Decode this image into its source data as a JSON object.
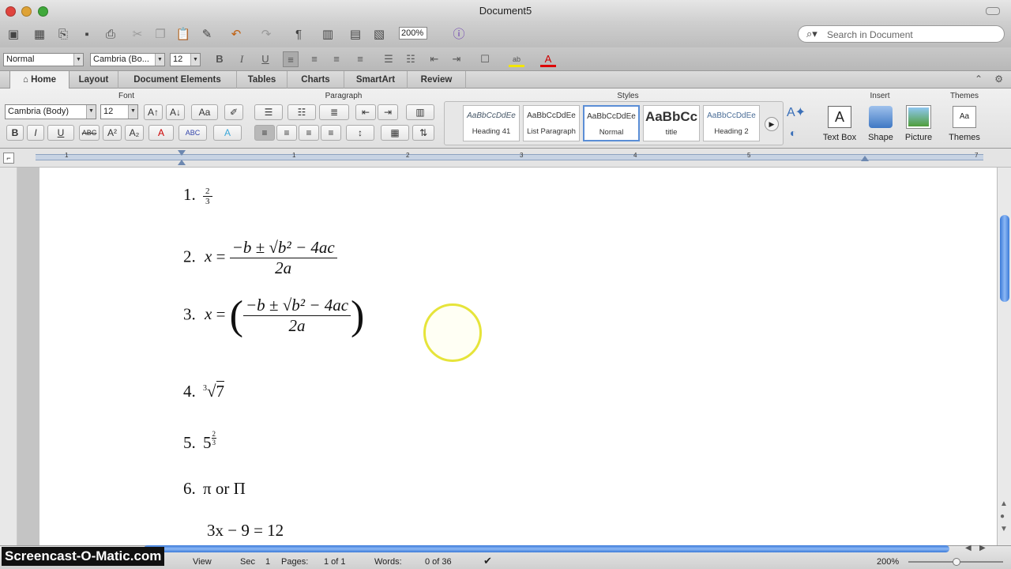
{
  "window": {
    "title": "Document5"
  },
  "toolbar": {
    "zoom": "200%",
    "search_placeholder": "Search in Document"
  },
  "format_bar": {
    "style": "Normal",
    "font": "Cambria (Bo...",
    "size": "12"
  },
  "ribbon_tabs": [
    "Home",
    "Layout",
    "Document Elements",
    "Tables",
    "Charts",
    "SmartArt",
    "Review"
  ],
  "ribbon": {
    "groups": {
      "font": "Font",
      "paragraph": "Paragraph",
      "styles": "Styles",
      "insert": "Insert",
      "themes": "Themes"
    },
    "font_name": "Cambria (Body)",
    "font_size": "12",
    "styles": [
      {
        "preview": "AaBbCcDdEe",
        "name": "Heading 41"
      },
      {
        "preview": "AaBbCcDdEe",
        "name": "List Paragraph"
      },
      {
        "preview": "AaBbCcDdEe",
        "name": "Normal"
      },
      {
        "preview": "AaBbCc",
        "name": "title"
      },
      {
        "preview": "AaBbCcDdEe",
        "name": "Heading 2"
      }
    ],
    "insert_items": [
      "Text Box",
      "Shape",
      "Picture"
    ],
    "themes_label": "Themes"
  },
  "ruler": {
    "numbers": [
      "1",
      "1",
      "2",
      "3",
      "4",
      "5",
      "7"
    ]
  },
  "document": {
    "eq1": {
      "n": "1.",
      "num": "2",
      "den": "3"
    },
    "eq2": {
      "n": "2.",
      "lhs": "x",
      "num": "−b ± √b² − 4ac",
      "den": "2a"
    },
    "eq3": {
      "n": "3.",
      "lhs": "x",
      "num": "−b ± √b² − 4ac",
      "den": "2a"
    },
    "eq4": {
      "n": "4.",
      "root_index": "3",
      "radicand": "7"
    },
    "eq5": {
      "n": "5.",
      "base": "5",
      "exp_num": "2",
      "exp_den": "3"
    },
    "eq6": {
      "n": "6.",
      "text": "π or Π"
    },
    "eq7": {
      "text": "3x − 9 = 12"
    }
  },
  "status": {
    "view": "View",
    "sec_label": "Sec",
    "sec_value": "1",
    "pages_label": "Pages:",
    "pages_value": "1 of 1",
    "words_label": "Words:",
    "words_value": "0 of 36",
    "zoom": "200%"
  },
  "watermark": "Screencast-O-Matic.com"
}
